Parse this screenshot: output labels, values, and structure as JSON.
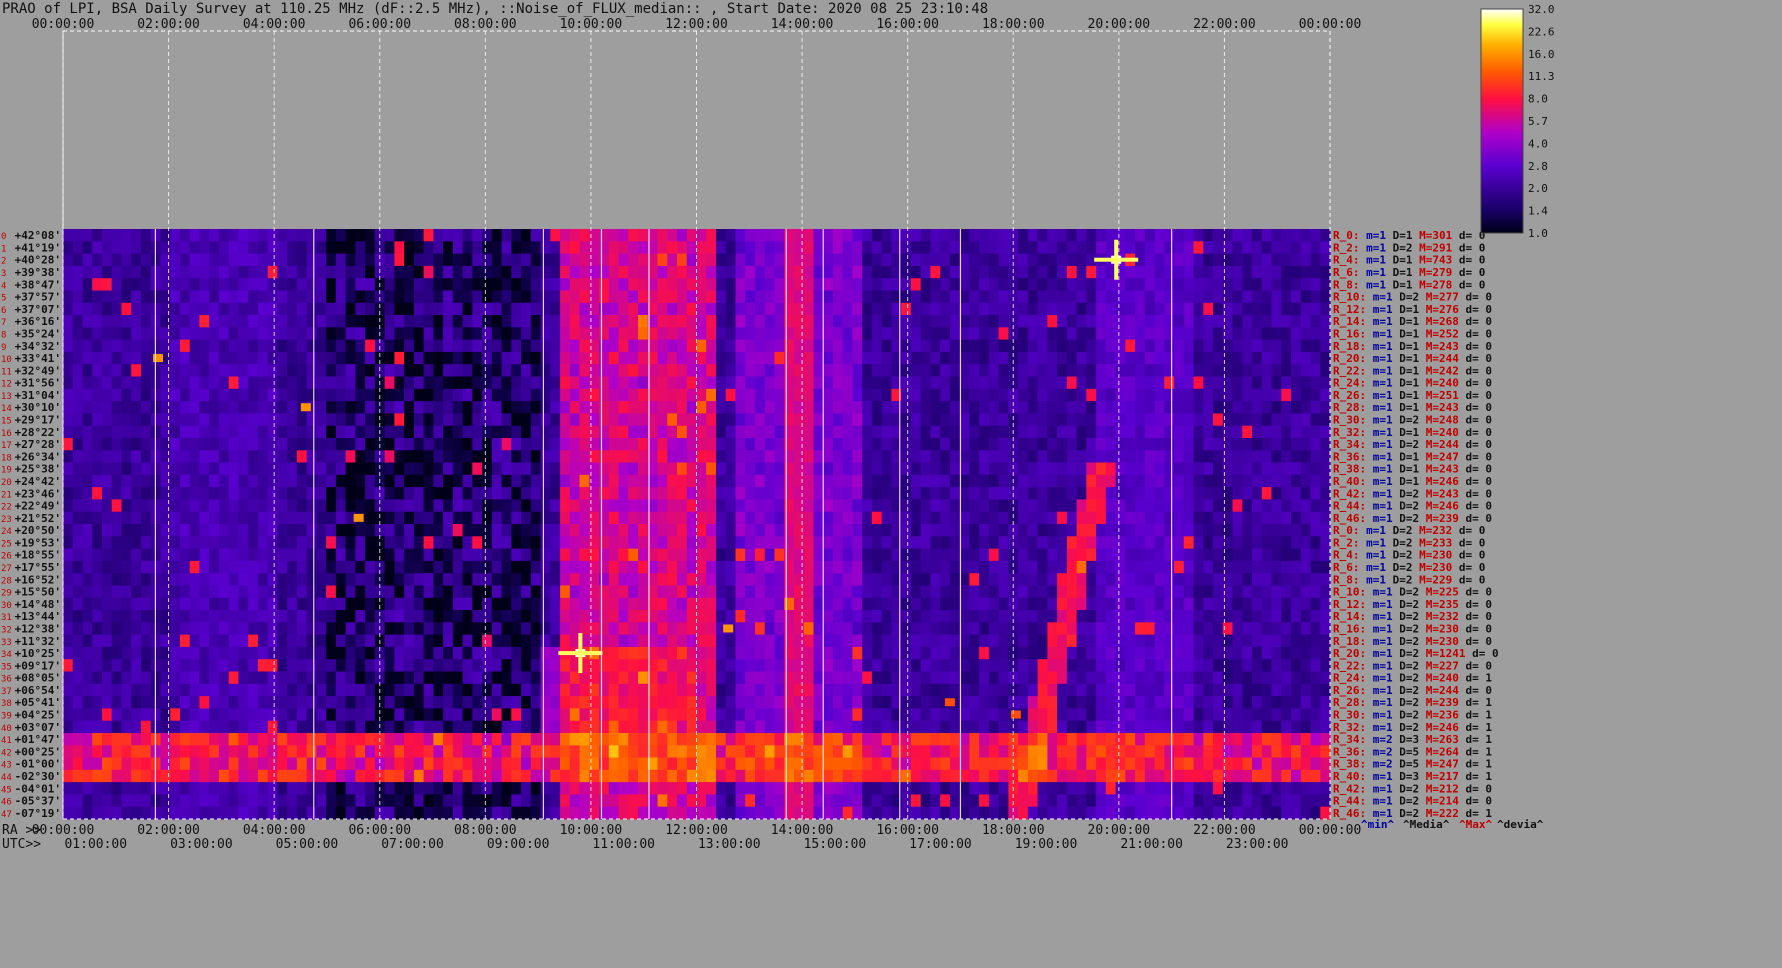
{
  "title": "PRAO of LPI, BSA Daily Survey at 110.25 MHz (dF::2.5 MHz), ::Noise_of_FLUX_median:: , Start Date: 2020 08 25 23:10:48",
  "top_axis_ticks": [
    "00:00:00",
    "02:00:00",
    "04:00:00",
    "06:00:00",
    "08:00:00",
    "10:00:00",
    "12:00:00",
    "14:00:00",
    "16:00:00",
    "18:00:00",
    "20:00:00",
    "22:00:00",
    "00:00:00"
  ],
  "ra_axis": {
    "label": "RA >>",
    "ticks": [
      "00:00:00",
      "02:00:00",
      "04:00:00",
      "06:00:00",
      "08:00:00",
      "10:00:00",
      "12:00:00",
      "14:00:00",
      "16:00:00",
      "18:00:00",
      "20:00:00",
      "22:00:00",
      "00:00:00"
    ]
  },
  "utc_axis": {
    "label": "UTC>>",
    "ticks": [
      "01:00:00",
      "03:00:00",
      "05:00:00",
      "07:00:00",
      "09:00:00",
      "11:00:00",
      "13:00:00",
      "15:00:00",
      "17:00:00",
      "19:00:00",
      "21:00:00",
      "23:00:00"
    ]
  },
  "colorbar": {
    "ticks": [
      "32.0",
      "22.6",
      "16.0",
      "11.3",
      "8.0",
      "5.7",
      "4.0",
      "2.8",
      "2.0",
      "1.4",
      "1.0"
    ]
  },
  "footer": {
    "min": "^min^",
    "median": "^Media^",
    "max": "^Max^",
    "dev": "^devia^"
  },
  "colors": {
    "background": "#9e9e9e",
    "row_label": "#c00000",
    "stat_m": "#0000a0",
    "stat_D": "#111111",
    "stat_M": "#c00000"
  },
  "chart_data": {
    "type": "heatmap",
    "title": "PRAO of LPI, BSA Daily Survey at 110.25 MHz (dF::2.5 MHz), ::Noise_of_FLUX_median:: , Start Date: 2020 08 25 23:10:48",
    "x_range_hours": [
      0,
      24
    ],
    "color_scale": [
      1.0,
      32.0
    ],
    "log_scale": true,
    "declinations": [
      "+42°08'",
      "+41°19'",
      "+40°28'",
      "+39°38'",
      "+38°47'",
      "+37°57'",
      "+37°07'",
      "+36°16'",
      "+35°24'",
      "+34°32'",
      "+33°41'",
      "+32°49'",
      "+31°56'",
      "+31°04'",
      "+30°10'",
      "+29°17'",
      "+28°22'",
      "+27°28'",
      "+26°34'",
      "+25°38'",
      "+24°42'",
      "+23°46'",
      "+22°49'",
      "+21°52'",
      "+20°50'",
      "+19°53'",
      "+18°55'",
      "+17°55'",
      "+16°52'",
      "+15°50'",
      "+14°48'",
      "+13°44'",
      "+12°38'",
      "+11°32'",
      "+10°25'",
      "+09°17'",
      "+08°05'",
      "+06°54'",
      "+05°41'",
      "+04°25'",
      "+03°07'",
      "+01°47'",
      "+00°25'",
      "-01°00'",
      "-02°30'",
      "-04°01'",
      "-05°37'",
      "-07°19'"
    ],
    "row_numbers": [
      "0",
      "1",
      "2",
      "3",
      "4",
      "5",
      "6",
      "7",
      "8",
      "9",
      "10",
      "11",
      "12",
      "13",
      "14",
      "15",
      "16",
      "17",
      "18",
      "19",
      "20",
      "21",
      "22",
      "23",
      "24",
      "25",
      "26",
      "27",
      "28",
      "29",
      "30",
      "31",
      "32",
      "33",
      "34",
      "35",
      "36",
      "37",
      "38",
      "39",
      "40",
      "41",
      "42",
      "43",
      "44",
      "45",
      "46",
      "47"
    ],
    "row_stats": [
      {
        "r": "R_0:",
        "m": "m=1",
        "D": "D=1",
        "M": "M=301",
        "d": "d= 0"
      },
      {
        "r": "R_2:",
        "m": "m=1",
        "D": "D=2",
        "M": "M=291",
        "d": "d= 0"
      },
      {
        "r": "R_4:",
        "m": "m=1",
        "D": "D=1",
        "M": "M=743",
        "d": "d= 0"
      },
      {
        "r": "R_6:",
        "m": "m=1",
        "D": "D=1",
        "M": "M=279",
        "d": "d= 0"
      },
      {
        "r": "R_8:",
        "m": "m=1",
        "D": "D=1",
        "M": "M=278",
        "d": "d= 0"
      },
      {
        "r": "R_10:",
        "m": "m=1",
        "D": "D=2",
        "M": "M=277",
        "d": "d= 0"
      },
      {
        "r": "R_12:",
        "m": "m=1",
        "D": "D=1",
        "M": "M=276",
        "d": "d= 0"
      },
      {
        "r": "R_14:",
        "m": "m=1",
        "D": "D=1",
        "M": "M=268",
        "d": "d= 0"
      },
      {
        "r": "R_16:",
        "m": "m=1",
        "D": "D=1",
        "M": "M=252",
        "d": "d= 0"
      },
      {
        "r": "R_18:",
        "m": "m=1",
        "D": "D=1",
        "M": "M=243",
        "d": "d= 0"
      },
      {
        "r": "R_20:",
        "m": "m=1",
        "D": "D=1",
        "M": "M=244",
        "d": "d= 0"
      },
      {
        "r": "R_22:",
        "m": "m=1",
        "D": "D=1",
        "M": "M=242",
        "d": "d= 0"
      },
      {
        "r": "R_24:",
        "m": "m=1",
        "D": "D=1",
        "M": "M=240",
        "d": "d= 0"
      },
      {
        "r": "R_26:",
        "m": "m=1",
        "D": "D=1",
        "M": "M=251",
        "d": "d= 0"
      },
      {
        "r": "R_28:",
        "m": "m=1",
        "D": "D=1",
        "M": "M=243",
        "d": "d= 0"
      },
      {
        "r": "R_30:",
        "m": "m=1",
        "D": "D=2",
        "M": "M=248",
        "d": "d= 0"
      },
      {
        "r": "R_32:",
        "m": "m=1",
        "D": "D=1",
        "M": "M=240",
        "d": "d= 0"
      },
      {
        "r": "R_34:",
        "m": "m=1",
        "D": "D=2",
        "M": "M=244",
        "d": "d= 0"
      },
      {
        "r": "R_36:",
        "m": "m=1",
        "D": "D=1",
        "M": "M=247",
        "d": "d= 0"
      },
      {
        "r": "R_38:",
        "m": "m=1",
        "D": "D=1",
        "M": "M=243",
        "d": "d= 0"
      },
      {
        "r": "R_40:",
        "m": "m=1",
        "D": "D=1",
        "M": "M=246",
        "d": "d= 0"
      },
      {
        "r": "R_42:",
        "m": "m=1",
        "D": "D=2",
        "M": "M=243",
        "d": "d= 0"
      },
      {
        "r": "R_44:",
        "m": "m=1",
        "D": "D=2",
        "M": "M=246",
        "d": "d= 0"
      },
      {
        "r": "R_46:",
        "m": "m=1",
        "D": "D=2",
        "M": "M=239",
        "d": "d= 0"
      },
      {
        "r": "R_0:",
        "m": "m=1",
        "D": "D=2",
        "M": "M=232",
        "d": "d= 0"
      },
      {
        "r": "R_2:",
        "m": "m=1",
        "D": "D=2",
        "M": "M=233",
        "d": "d= 0"
      },
      {
        "r": "R_4:",
        "m": "m=1",
        "D": "D=2",
        "M": "M=230",
        "d": "d= 0"
      },
      {
        "r": "R_6:",
        "m": "m=1",
        "D": "D=2",
        "M": "M=230",
        "d": "d= 0"
      },
      {
        "r": "R_8:",
        "m": "m=1",
        "D": "D=2",
        "M": "M=229",
        "d": "d= 0"
      },
      {
        "r": "R_10:",
        "m": "m=1",
        "D": "D=2",
        "M": "M=225",
        "d": "d= 0"
      },
      {
        "r": "R_12:",
        "m": "m=1",
        "D": "D=2",
        "M": "M=235",
        "d": "d= 0"
      },
      {
        "r": "R_14:",
        "m": "m=1",
        "D": "D=2",
        "M": "M=232",
        "d": "d= 0"
      },
      {
        "r": "R_16:",
        "m": "m=1",
        "D": "D=2",
        "M": "M=230",
        "d": "d= 0"
      },
      {
        "r": "R_18:",
        "m": "m=1",
        "D": "D=2",
        "M": "M=230",
        "d": "d= 0"
      },
      {
        "r": "R_20:",
        "m": "m=1",
        "D": "D=2",
        "M": "M=1241",
        "d": "d= 0"
      },
      {
        "r": "R_22:",
        "m": "m=1",
        "D": "D=2",
        "M": "M=227",
        "d": "d= 0"
      },
      {
        "r": "R_24:",
        "m": "m=1",
        "D": "D=2",
        "M": "M=240",
        "d": "d= 1"
      },
      {
        "r": "R_26:",
        "m": "m=1",
        "D": "D=2",
        "M": "M=244",
        "d": "d= 0"
      },
      {
        "r": "R_28:",
        "m": "m=1",
        "D": "D=2",
        "M": "M=239",
        "d": "d= 1"
      },
      {
        "r": "R_30:",
        "m": "m=1",
        "D": "D=2",
        "M": "M=236",
        "d": "d= 1"
      },
      {
        "r": "R_32:",
        "m": "m=1",
        "D": "D=2",
        "M": "M=246",
        "d": "d= 1"
      },
      {
        "r": "R_34:",
        "m": "m=2",
        "D": "D=3",
        "M": "M=263",
        "d": "d= 1"
      },
      {
        "r": "R_36:",
        "m": "m=2",
        "D": "D=5",
        "M": "M=264",
        "d": "d= 1"
      },
      {
        "r": "R_38:",
        "m": "m=2",
        "D": "D=5",
        "M": "M=247",
        "d": "d= 1"
      },
      {
        "r": "R_40:",
        "m": "m=1",
        "D": "D=3",
        "M": "M=217",
        "d": "d= 1"
      },
      {
        "r": "R_42:",
        "m": "m=1",
        "D": "D=2",
        "M": "M=212",
        "d": "d= 0"
      },
      {
        "r": "R_44:",
        "m": "m=1",
        "D": "D=2",
        "M": "M=214",
        "d": "d= 0"
      },
      {
        "r": "R_46:",
        "m": "m=1",
        "D": "D=2",
        "M": "M=222",
        "d": "d= 1"
      }
    ],
    "bright_sources": [
      {
        "hour": 19.95,
        "row": 2,
        "value": 32
      },
      {
        "hour": 9.8,
        "row": 34,
        "value": 32
      },
      {
        "hour": 5.6,
        "row": 23,
        "value": 16
      },
      {
        "hour": 1.8,
        "row": 10,
        "value": 16
      },
      {
        "hour": 4.6,
        "row": 14,
        "value": 16
      },
      {
        "hour": 12.6,
        "row": 32,
        "value": 16
      },
      {
        "hour": 18.05,
        "row": 39,
        "value": 11.3
      },
      {
        "hour": 16.8,
        "row": 38,
        "value": 11.3
      }
    ]
  }
}
